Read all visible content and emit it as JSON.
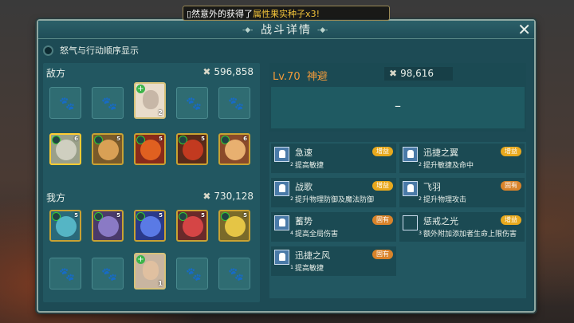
{
  "notice": {
    "prefix": "▯然意外的获得了",
    "highlight": "属性果实种子x3!"
  },
  "panel": {
    "title": "战斗详情",
    "toggle_label": "怒气与行动顺序显示"
  },
  "enemy": {
    "label": "敌方",
    "power": "596,858",
    "portrait_count": "2",
    "heroes": [
      {
        "level": "6",
        "color": "#9aa08a",
        "face": "#cfcfc0"
      },
      {
        "level": "5",
        "color": "#7a5a2a",
        "face": "#d9a055"
      },
      {
        "level": "5",
        "color": "#8a2a1a",
        "face": "#e06020"
      },
      {
        "level": "5",
        "color": "#5a2a1a",
        "face": "#c23a20"
      },
      {
        "level": "6",
        "color": "#8a4a2a",
        "face": "#e8b070"
      }
    ]
  },
  "ally": {
    "label": "我方",
    "power": "730,128",
    "portrait_count": "1",
    "heroes": [
      {
        "level": "5",
        "color": "#2a6a7a",
        "face": "#55b5c5"
      },
      {
        "level": "5",
        "color": "#4a3a6a",
        "face": "#8a7ac5"
      },
      {
        "level": "5",
        "color": "#2a3a8a",
        "face": "#5a7ae5"
      },
      {
        "level": "5",
        "color": "#6a2a2a",
        "face": "#d54545"
      },
      {
        "level": "5",
        "color": "#7a6a2a",
        "face": "#e5c545"
      }
    ]
  },
  "unit": {
    "level": "Lv.70",
    "name": "神避",
    "power": "98,616",
    "value": "–"
  },
  "buffs": [
    {
      "name": "急速",
      "desc": "提高敏捷",
      "tag": "增益",
      "tag_color": "y",
      "count": "2"
    },
    {
      "name": "迅捷之翼",
      "desc": "提升敏捷及命中",
      "tag": "增益",
      "tag_color": "y",
      "count": "2"
    },
    {
      "name": "战歌",
      "desc": "提升物理防御及魔法防御",
      "tag": "增益",
      "tag_color": "y",
      "count": "2"
    },
    {
      "name": "飞羽",
      "desc": "提升物理攻击",
      "tag": "固有",
      "tag_color": "o",
      "count": "2"
    },
    {
      "name": "蓄势",
      "desc": "提高全局伤害",
      "tag": "固有",
      "tag_color": "o",
      "count": "4"
    },
    {
      "name": "惩戒之光",
      "desc": "额外附加添加者生命上限伤害",
      "tag": "增益",
      "tag_color": "y",
      "count": "3"
    },
    {
      "name": "迅捷之风",
      "desc": "提高敏捷",
      "tag": "固有",
      "tag_color": "o",
      "count": "1"
    }
  ]
}
